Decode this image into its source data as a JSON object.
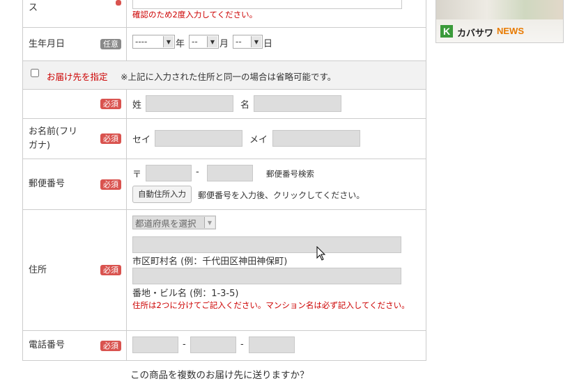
{
  "email_confirm": {
    "label_tail": "ス",
    "note": "確認のため2度入力してください。"
  },
  "birthday": {
    "label": "生年月日",
    "badge": "任意",
    "year_value": "----",
    "year_unit": "年",
    "month_value": "--",
    "month_unit": "月",
    "day_value": "--",
    "day_unit": "日"
  },
  "delivery": {
    "checkbox_label": "お届け先を指定",
    "note": "※上記に入力された住所と同一の場合は省略可能です。"
  },
  "name": {
    "badge": "必須",
    "sei_label": "姓",
    "mei_label": "名"
  },
  "kana": {
    "label": "お名前(フリガナ)",
    "badge": "必須",
    "sei_label": "セイ",
    "mei_label": "メイ"
  },
  "postal": {
    "label": "郵便番号",
    "badge": "必須",
    "prefix": "〒",
    "dash": "-",
    "search_link": "郵便番号検索",
    "auto_button": "自動住所入力",
    "hint": "郵便番号を入力後、クリックしてください。"
  },
  "address": {
    "label": "住所",
    "badge": "必須",
    "prefecture_select": "都道府県を選択",
    "city_hint": "市区町村名 (例：千代田区神田神保町)",
    "street_hint": "番地・ビル名 (例：1-3-5)",
    "note": "住所は2つに分けてご記入ください。マンション名は必ず記入してください。"
  },
  "phone": {
    "label": "電話番号",
    "badge": "必須",
    "dash": "-"
  },
  "multi_delivery_question": "この商品を複数のお届け先に送りますか？",
  "banner": {
    "text_black": "カバサワ",
    "text_orange": "NEWS",
    "icon": "k-logo-icon"
  },
  "colors": {
    "required_badge": "#d9534f",
    "optional_badge": "#8a8a8a",
    "error_text": "#cc0000",
    "banner_orange": "#e87a00",
    "banner_green": "#3a9a3a"
  }
}
